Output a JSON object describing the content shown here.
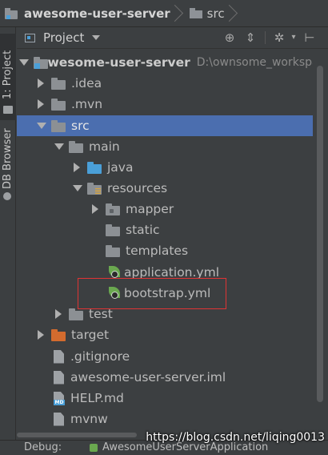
{
  "breadcrumb": {
    "project": "awesome-user-server",
    "folder": "src"
  },
  "tool_window_strip": {
    "project_tab": "1: Project",
    "db_tab": "DB Browser"
  },
  "project_panel": {
    "title": "Project"
  },
  "tree": {
    "root": {
      "label": "awesome-user-server",
      "path": "D:\\ownsome_workspac"
    },
    "items": [
      {
        "label": ".idea"
      },
      {
        "label": ".mvn"
      },
      {
        "label": "src"
      },
      {
        "label": "main"
      },
      {
        "label": "java"
      },
      {
        "label": "resources"
      },
      {
        "label": "mapper"
      },
      {
        "label": "static"
      },
      {
        "label": "templates"
      },
      {
        "label": "application.yml"
      },
      {
        "label": "bootstrap.yml"
      },
      {
        "label": "test"
      },
      {
        "label": "target"
      },
      {
        "label": ".gitignore"
      },
      {
        "label": "awesome-user-server.iml"
      },
      {
        "label": "HELP.md"
      },
      {
        "label": "mvnw"
      }
    ]
  },
  "file_tags": {
    "md": "MD"
  },
  "bottom_bar": {
    "debug_label": "Debug:",
    "app_label": "AwesomeUserServerApplication"
  },
  "watermark": "https://blog.csdn.net/liqing0013",
  "colors": {
    "background": "#3c3f41",
    "selection": "#4b6eaf",
    "highlight_box": "#e03434"
  }
}
